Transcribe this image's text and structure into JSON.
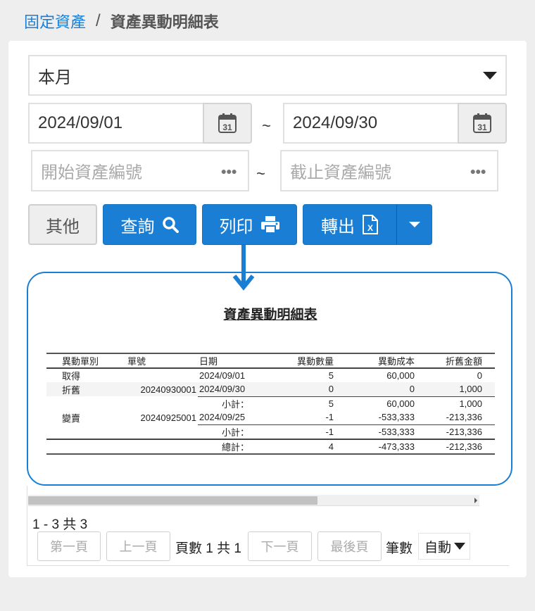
{
  "breadcrumb": {
    "parent": "固定資產",
    "separator": "/",
    "current": "資產異動明細表"
  },
  "filters": {
    "period_select": "本月",
    "date_from": "2024/09/01",
    "date_to": "2024/09/30",
    "range_sep": "~",
    "calendar_day": "31",
    "asset_from_placeholder": "開始資產編號",
    "asset_to_placeholder": "截止資產編號"
  },
  "buttons": {
    "other": "其他",
    "query": "查詢",
    "print": "列印",
    "export": "轉出"
  },
  "report": {
    "title": "資產異動明細表",
    "columns": [
      "異動單別",
      "單號",
      "日期",
      "異動數量",
      "異動成本",
      "折舊金額"
    ],
    "rows": [
      [
        "取得",
        "",
        "2024/09/01",
        "5",
        "60,000",
        "0"
      ],
      [
        "折舊",
        "20240930001",
        "2024/09/30",
        "0",
        "0",
        "1,000"
      ],
      [
        "",
        "",
        "小計：",
        "5",
        "60,000",
        "1,000"
      ],
      [
        "變賣",
        "20240925001",
        "2024/09/25",
        "-1",
        "-533,333",
        "-213,336"
      ],
      [
        "",
        "",
        "小計：",
        "-1",
        "-533,333",
        "-213,336"
      ],
      [
        "",
        "",
        "總計：",
        "4",
        "-473,333",
        "-212,336"
      ]
    ]
  },
  "pager": {
    "summary": "1 - 3 共 3",
    "first": "第一頁",
    "prev": "上一頁",
    "page_info": "頁數 1 共 1",
    "next": "下一頁",
    "last": "最後頁",
    "size_label": "筆數",
    "size_value": "自動"
  },
  "colors": {
    "accent": "#1a7fd4"
  }
}
